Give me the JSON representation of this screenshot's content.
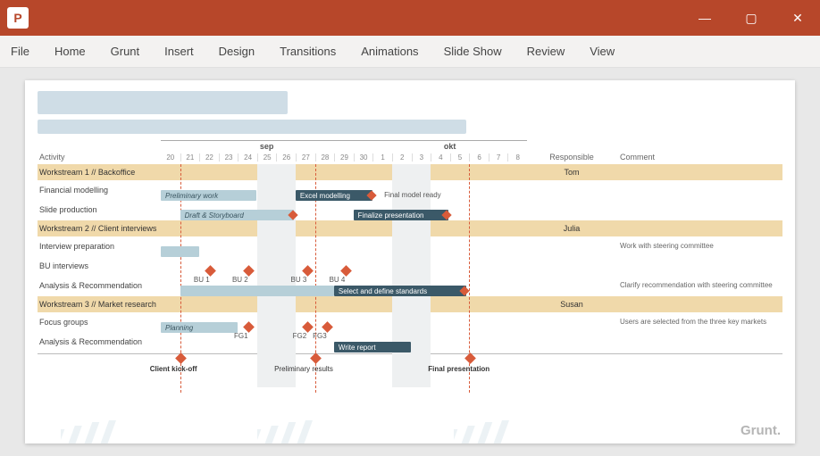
{
  "app": {
    "icon_letter": "P"
  },
  "window_controls": {
    "min": "—",
    "max": "▢",
    "close": "✕"
  },
  "ribbon": [
    "File",
    "Home",
    "Grunt",
    "Insert",
    "Design",
    "Transitions",
    "Animations",
    "Slide Show",
    "Review",
    "View"
  ],
  "headers": {
    "activity": "Activity",
    "responsible": "Responsible",
    "comment": "Comment"
  },
  "months": [
    {
      "label": "sep",
      "span": 11
    },
    {
      "label": "okt",
      "span": 8
    }
  ],
  "days": [
    "20",
    "21",
    "22",
    "23",
    "24",
    "25",
    "26",
    "27",
    "28",
    "29",
    "30",
    "1",
    "2",
    "3",
    "4",
    "5",
    "6",
    "7",
    "8"
  ],
  "workstreams": [
    {
      "title": "Workstream 1 // Backoffice",
      "responsible": "Tom"
    },
    {
      "title": "Workstream 2 // Client interviews",
      "responsible": "Julia"
    },
    {
      "title": "Workstream 3 // Market research",
      "responsible": "Susan"
    }
  ],
  "tasks": {
    "fin_model": {
      "name": "Financial modelling",
      "bar1": "Preliminary work",
      "bar2": "Excel modelling",
      "post": "Final model ready"
    },
    "slide_prod": {
      "name": "Slide production",
      "bar1": "Draft & Storyboard",
      "bar2": "Finalize presentation"
    },
    "interview_prep": {
      "name": "Interview preparation",
      "comment": "Work with steering committee"
    },
    "bu_interviews": {
      "name": "BU interviews",
      "ms": [
        "BU 1",
        "BU 2",
        "BU 3",
        "BU 4"
      ]
    },
    "analysis_rec": {
      "name": "Analysis & Recommendation",
      "bar1": "Select and define standards",
      "comment": "Clarify recommendation with steering committee"
    },
    "focus_groups": {
      "name": "Focus groups",
      "bar1": "Planning",
      "ms": [
        "FG1",
        "FG2",
        "FG3"
      ]
    },
    "analysis_rec2": {
      "name": "Analysis & Recommendation",
      "bar1": "Write report",
      "comment": "Users are selected from the three key markets"
    }
  },
  "bottom_milestones": [
    {
      "label": "Client kick-off",
      "bold": true
    },
    {
      "label": "Preliminary results",
      "bold": false
    },
    {
      "label": "Final presentation",
      "bold": true
    }
  ],
  "brand": "Grunt."
}
